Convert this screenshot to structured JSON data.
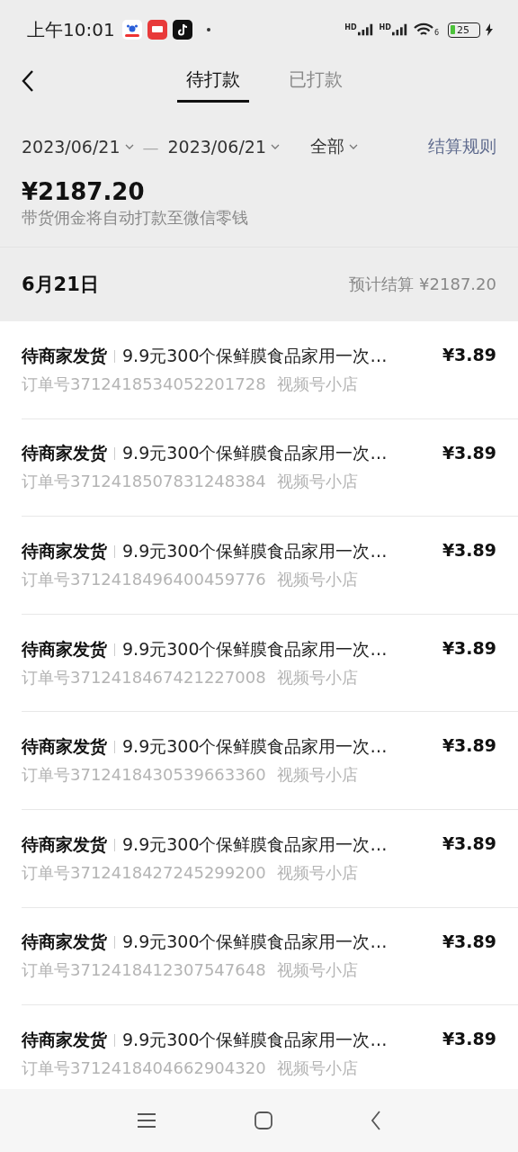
{
  "status_bar": {
    "time": "上午10:01",
    "signal_labels": [
      "HD",
      "HD"
    ],
    "wifi_label": "6",
    "battery": "25"
  },
  "nav": {
    "tabs": [
      {
        "label": "待打款",
        "selected": true
      },
      {
        "label": "已打款",
        "selected": false
      }
    ]
  },
  "filters": {
    "start_date": "2023/06/21",
    "separator": "—",
    "end_date": "2023/06/21",
    "category": "全部",
    "rules_link": "结算规则"
  },
  "summary": {
    "amount": "¥2187.20",
    "note": "带货佣金将自动打款至微信零钱"
  },
  "day_header": {
    "date": "6月21日",
    "estimate": "预计结算 ¥2187.20"
  },
  "orders": [
    {
      "status": "待商家发货",
      "title": "9.9元300个保鲜膜食品家用一次…",
      "order_no": "订单号3712418534052201728",
      "shop": "视频号小店",
      "amount": "¥3.89"
    },
    {
      "status": "待商家发货",
      "title": "9.9元300个保鲜膜食品家用一次…",
      "order_no": "订单号3712418507831248384",
      "shop": "视频号小店",
      "amount": "¥3.89"
    },
    {
      "status": "待商家发货",
      "title": "9.9元300个保鲜膜食品家用一次…",
      "order_no": "订单号3712418496400459776",
      "shop": "视频号小店",
      "amount": "¥3.89"
    },
    {
      "status": "待商家发货",
      "title": "9.9元300个保鲜膜食品家用一次…",
      "order_no": "订单号3712418467421227008",
      "shop": "视频号小店",
      "amount": "¥3.89"
    },
    {
      "status": "待商家发货",
      "title": "9.9元300个保鲜膜食品家用一次…",
      "order_no": "订单号3712418430539663360",
      "shop": "视频号小店",
      "amount": "¥3.89"
    },
    {
      "status": "待商家发货",
      "title": "9.9元300个保鲜膜食品家用一次…",
      "order_no": "订单号3712418427245299200",
      "shop": "视频号小店",
      "amount": "¥3.89"
    },
    {
      "status": "待商家发货",
      "title": "9.9元300个保鲜膜食品家用一次…",
      "order_no": "订单号3712418412307547648",
      "shop": "视频号小店",
      "amount": "¥3.89"
    },
    {
      "status": "待商家发货",
      "title": "9.9元300个保鲜膜食品家用一次…",
      "order_no": "订单号3712418404662904320",
      "shop": "视频号小店",
      "amount": "¥3.89"
    }
  ]
}
